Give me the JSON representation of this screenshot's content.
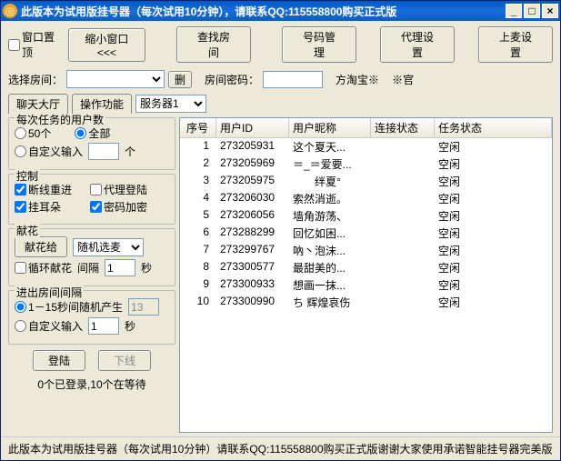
{
  "title": "此版本为试用版挂号器（每次试用10分钟），请联系QQ:115558800购买正式版",
  "toolbar": {
    "pin": "窗口置顶",
    "shrink": "缩小窗口<<<",
    "findroom": "查找房间",
    "nummgr": "号码管理",
    "proxy": "代理设置",
    "mic": "上麦设置"
  },
  "row2": {
    "sel_room": "选择房间：",
    "del": "删",
    "room_pwd": "房间密码：",
    "taobao": "方淘宝※",
    "note": "※官"
  },
  "tabs": {
    "chat": "聊天大厅",
    "oper": "操作功能",
    "server": "服务器1"
  },
  "grp_users": {
    "cap": "每次任务的用户数",
    "opt50": "50个",
    "optall": "全部",
    "optcustom": "自定义输入",
    "unit": "个"
  },
  "grp_ctrl": {
    "cap": "控制",
    "reconnect": "断线重进",
    "proxylogin": "代理登陆",
    "hangear": "挂耳朵",
    "pwdenc": "密码加密"
  },
  "grp_flower": {
    "cap": "献花",
    "give": "献花给",
    "randmic": "随机选麦",
    "loop": "循环献花",
    "interval": "间隔",
    "unit": "秒",
    "ival_val": "1"
  },
  "grp_room": {
    "cap": "进出房间间隔",
    "rand": "1－15秒间随机产生",
    "rand_val": "13",
    "custom": "自定义输入",
    "cust_val": "1",
    "unit": "秒"
  },
  "btns": {
    "login": "登陆",
    "logout": "下线"
  },
  "status": "0个已登录,10个在等待",
  "cols": {
    "seq": "序号",
    "uid": "用户ID",
    "nick": "用户昵称",
    "conn": "连接状态",
    "task": "任务状态"
  },
  "rows": [
    {
      "seq": "1",
      "uid": "273205931",
      "nick": "这个夏天...",
      "conn": "",
      "task": "空闲"
    },
    {
      "seq": "2",
      "uid": "273205969",
      "nick": "＝_＝爱要...",
      "conn": "",
      "task": "空闲"
    },
    {
      "seq": "3",
      "uid": "273205975",
      "nick": "　　绊夏°",
      "conn": "",
      "task": "空闲"
    },
    {
      "seq": "4",
      "uid": "273206030",
      "nick": "索然消逝。",
      "conn": "",
      "task": "空闲"
    },
    {
      "seq": "5",
      "uid": "273206056",
      "nick": "墙角游荡、",
      "conn": "",
      "task": "空闲"
    },
    {
      "seq": "6",
      "uid": "273288299",
      "nick": "回忆如困...",
      "conn": "",
      "task": "空闲"
    },
    {
      "seq": "7",
      "uid": "273299767",
      "nick": "吶丶泡沫...",
      "conn": "",
      "task": "空闲"
    },
    {
      "seq": "8",
      "uid": "273300577",
      "nick": "最甜美的...",
      "conn": "",
      "task": "空闲"
    },
    {
      "seq": "9",
      "uid": "273300933",
      "nick": "想画一抹...",
      "conn": "",
      "task": "空闲"
    },
    {
      "seq": "10",
      "uid": "273300990",
      "nick": "ち 辉煌哀伤",
      "conn": "",
      "task": "空闲"
    }
  ],
  "footer": "此版本为试用版挂号器（每次试用10分钟）请联系QQ:115558800购买正式版谢谢大家使用承诺智能挂号器完美版"
}
